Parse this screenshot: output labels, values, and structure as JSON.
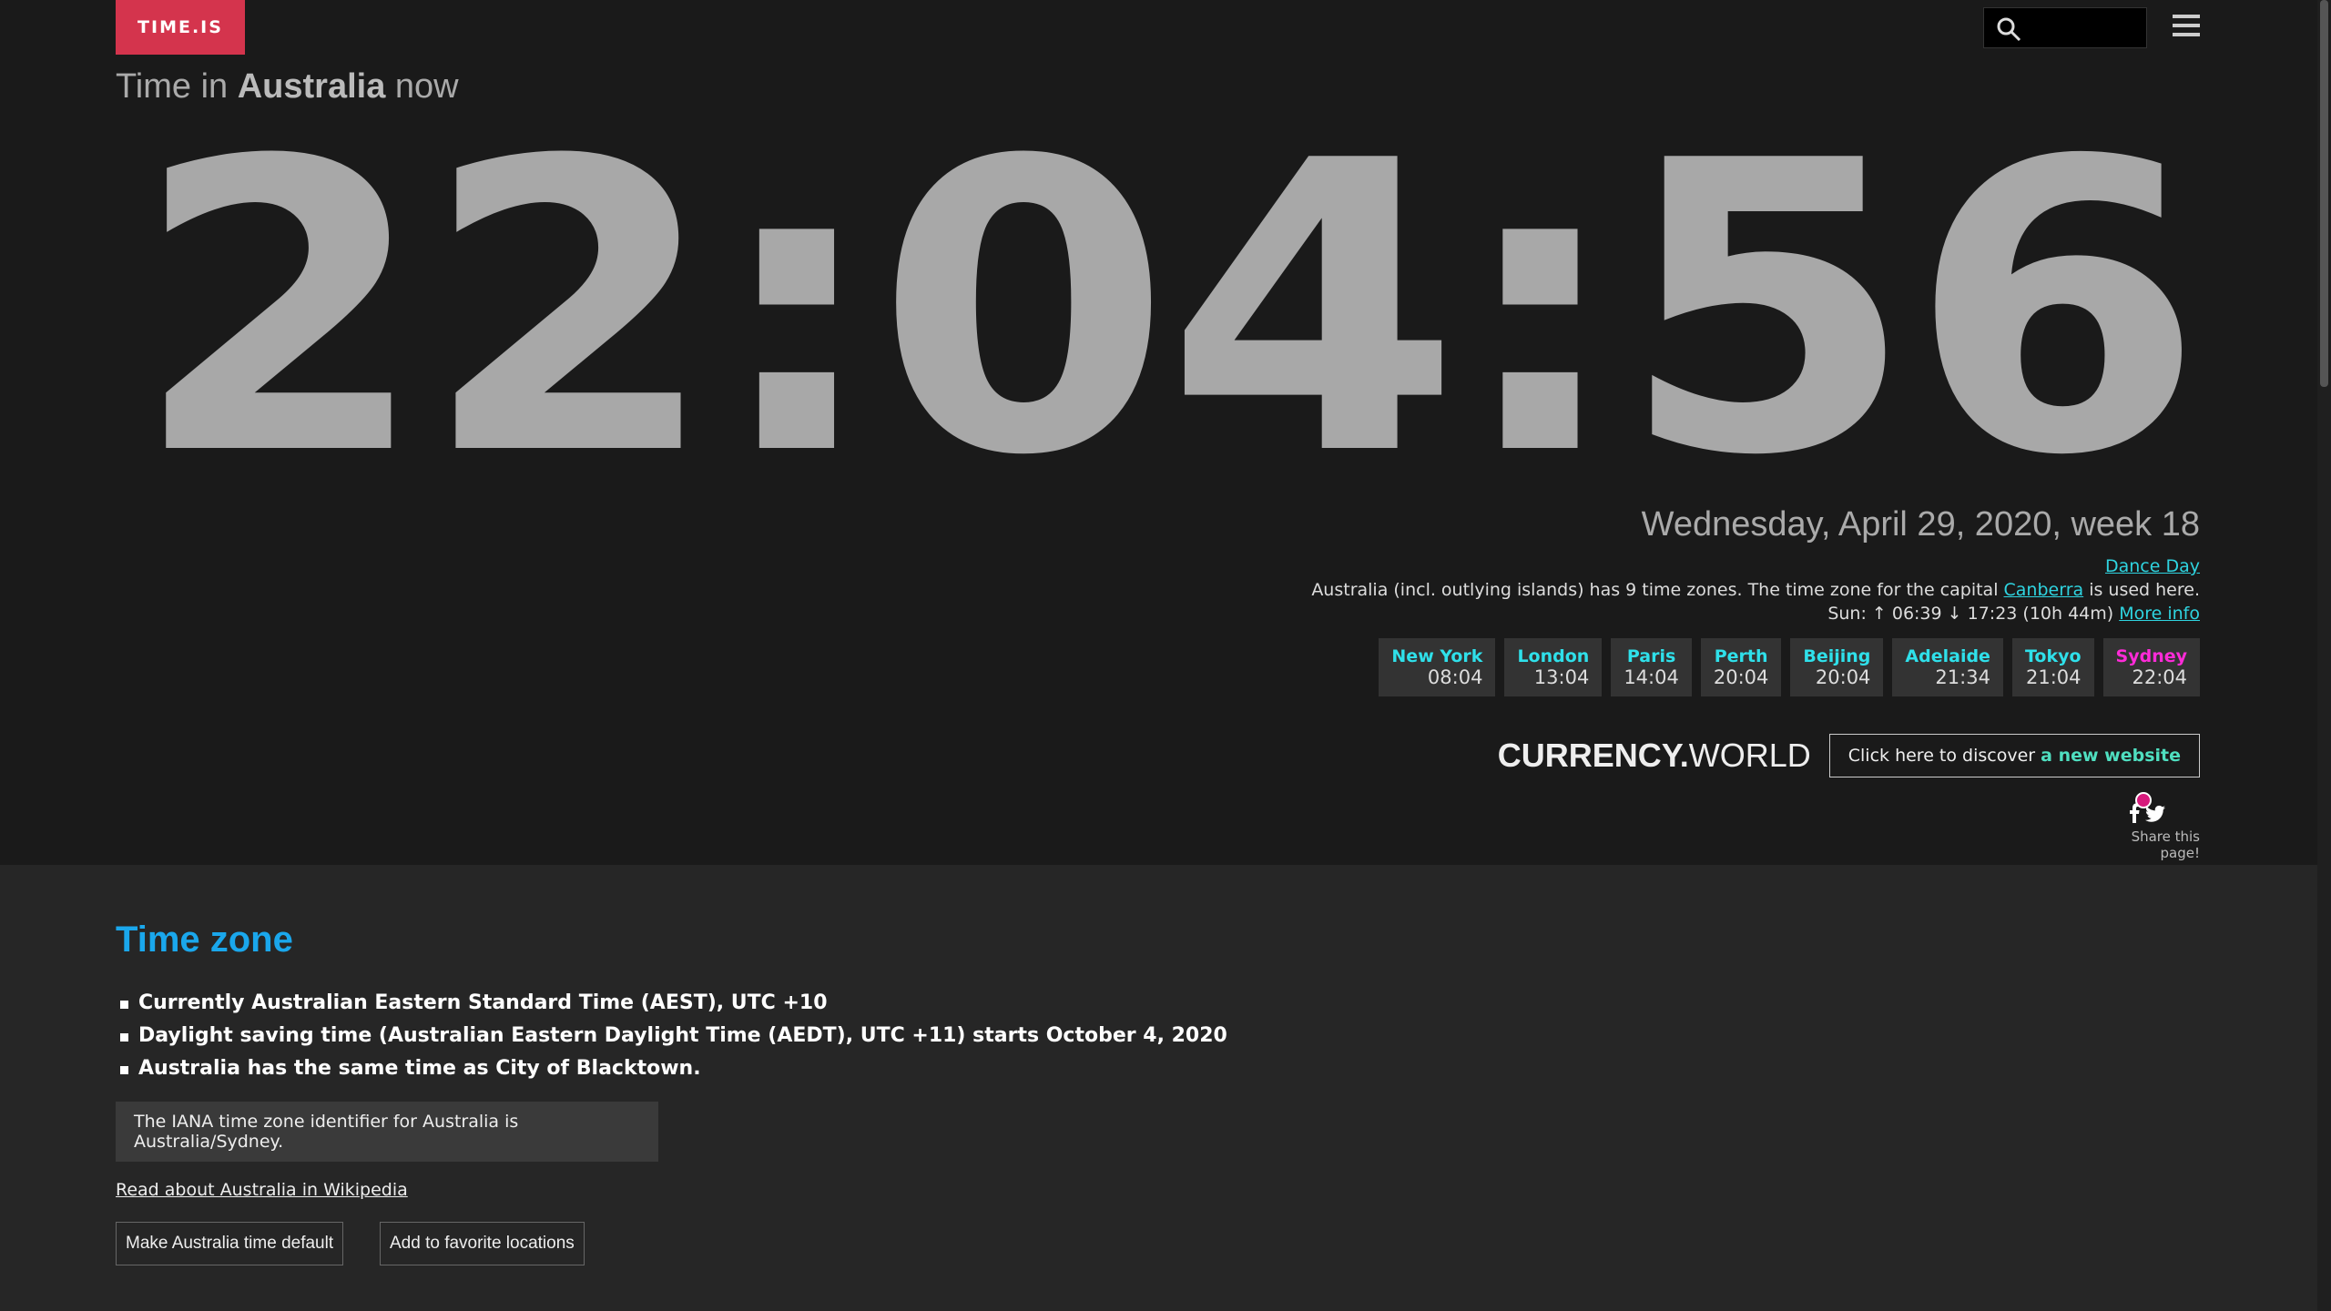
{
  "header": {
    "logo": "TIME.IS",
    "search_placeholder": "",
    "title_prefix": "Time in ",
    "title_location": "Australia",
    "title_suffix": " now"
  },
  "clock": {
    "time": "22:04:56"
  },
  "date": {
    "line": "Wednesday, April 29, 2020, week 18",
    "holiday": "Dance Day",
    "zone_text_before": "Australia (incl. outlying islands) has 9 time zones. The time zone for the capital ",
    "capital": "Canberra",
    "zone_text_after": " is used here.",
    "sun_text": "Sun: ↑ 06:39 ↓ 17:23 (10h 44m) ",
    "more_info": "More info"
  },
  "cities": [
    {
      "name": "New York",
      "time": "08:04",
      "current": false
    },
    {
      "name": "London",
      "time": "13:04",
      "current": false
    },
    {
      "name": "Paris",
      "time": "14:04",
      "current": false
    },
    {
      "name": "Perth",
      "time": "20:04",
      "current": false
    },
    {
      "name": "Beijing",
      "time": "20:04",
      "current": false
    },
    {
      "name": "Adelaide",
      "time": "21:34",
      "current": false
    },
    {
      "name": "Tokyo",
      "time": "21:04",
      "current": false
    },
    {
      "name": "Sydney",
      "time": "22:04",
      "current": true
    }
  ],
  "promo": {
    "brand_bold": "CURRENCY.",
    "brand_rest": "WORLD",
    "discover_prefix": "Click here to discover ",
    "discover_bold": "a new website"
  },
  "share": {
    "label": "Share this page!"
  },
  "timezone": {
    "title": "Time zone",
    "items": [
      "Currently Australian Eastern Standard Time (AEST), UTC +10",
      "Daylight saving time (Australian Eastern Daylight Time (AEDT), UTC +11) starts October 4, 2020",
      "Australia has the same time as City of Blacktown."
    ],
    "iana": "The IANA time zone identifier for Australia is Australia/Sydney.",
    "wiki": "Read about Australia in Wikipedia",
    "btn_default": "Make Australia time default",
    "btn_favorite": "Add to favorite locations"
  },
  "colors": {
    "logo_bg": "#d4344d",
    "city_name": "#2fe0ea",
    "current_city": "#ff2bd8",
    "link": "#2fd4e0",
    "section_title": "#1aa7ec"
  }
}
